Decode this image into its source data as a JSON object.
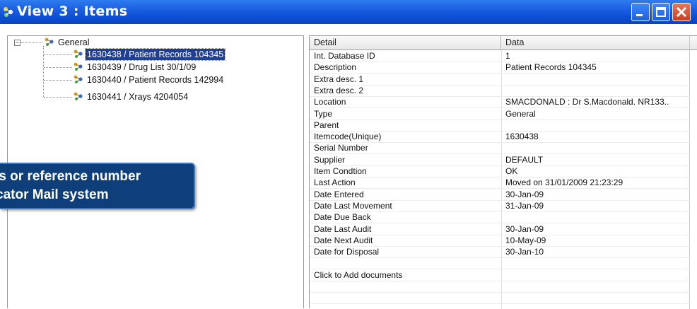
{
  "window": {
    "title": "View 3 : Items",
    "colors": {
      "titlebar": "#0d4fd4",
      "selection": "#1f3f95",
      "callout": "#0f3f7a"
    }
  },
  "tree": {
    "root": {
      "label": "General",
      "icon": "node-icon"
    },
    "items": [
      {
        "label": "1630438 / Patient Records 104345",
        "selected": true
      },
      {
        "label": "1630439 / Drug List 30/1/09",
        "selected": false
      },
      {
        "label": "1630440 / Patient Records 142994",
        "selected": false
      },
      {
        "label": "1630441 / Xrays 4204054",
        "selected": false
      }
    ]
  },
  "callout": {
    "line1": "ts or reference number",
    "line2": "cator Mail system"
  },
  "grid": {
    "headers": {
      "detail": "Detail",
      "data": "Data"
    },
    "rows": [
      {
        "detail": "Int. Database ID",
        "data": "1"
      },
      {
        "detail": "Description",
        "data": "Patient Records 104345"
      },
      {
        "detail": "Extra desc. 1",
        "data": ""
      },
      {
        "detail": "Extra desc. 2",
        "data": ""
      },
      {
        "detail": "Location",
        "data": "SMACDONALD : Dr S.Macdonald. NR133.."
      },
      {
        "detail": "Type",
        "data": "General"
      },
      {
        "detail": "Parent",
        "data": ""
      },
      {
        "detail": "Itemcode(Unique)",
        "data": "1630438"
      },
      {
        "detail": "Serial Number",
        "data": ""
      },
      {
        "detail": "Supplier",
        "data": "DEFAULT"
      },
      {
        "detail": "Item Condtion",
        "data": "OK"
      },
      {
        "detail": "Last Action",
        "data": "Moved on 31/01/2009 21:23:29"
      },
      {
        "detail": "Date Entered",
        "data": "30-Jan-09"
      },
      {
        "detail": "Date Last Movement",
        "data": "31-Jan-09"
      },
      {
        "detail": "Date Due Back",
        "data": ""
      },
      {
        "detail": "Date Last Audit",
        "data": "30-Jan-09"
      },
      {
        "detail": "Date Next Audit",
        "data": "10-May-09"
      },
      {
        "detail": "Date for Disposal",
        "data": "30-Jan-10"
      },
      {
        "detail": "",
        "data": ""
      },
      {
        "detail": "Click to Add documents",
        "data": ""
      },
      {
        "detail": "",
        "data": ""
      },
      {
        "detail": "",
        "data": ""
      }
    ]
  }
}
